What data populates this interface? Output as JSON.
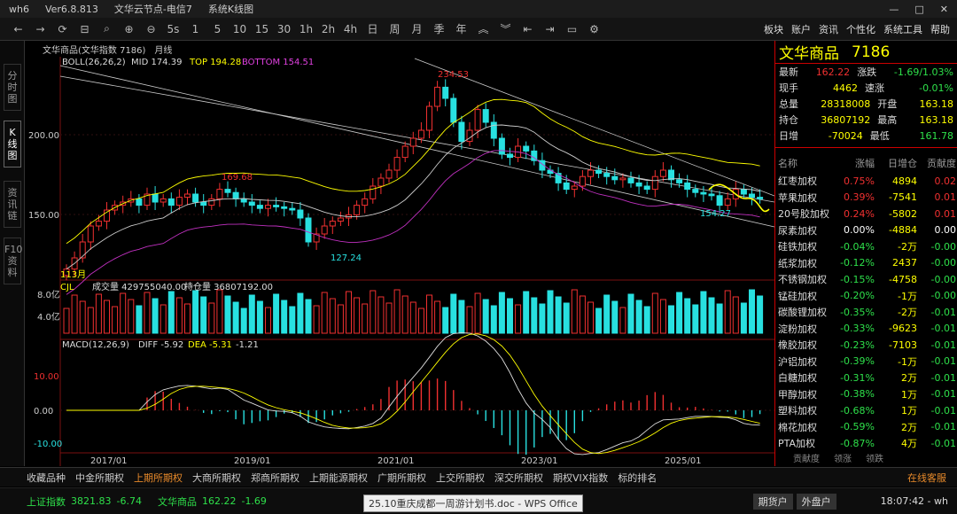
{
  "titlebar": {
    "app": "wh6",
    "version": "Ver6.8.813",
    "server": "文华云节点-电信7",
    "mode": "系统K线图",
    "win": [
      "—",
      "□",
      "✕"
    ]
  },
  "toolbar": {
    "buttons": [
      "←",
      "→",
      "⟳",
      "⊟",
      "⌕",
      "⊕",
      "⊖",
      "5s",
      "1",
      "5",
      "10",
      "15",
      "30",
      "1h",
      "2h",
      "4h",
      "日",
      "周",
      "月",
      "季",
      "年",
      "︽",
      "︾",
      "⇤",
      "⇥",
      "▭",
      "⚙"
    ],
    "menus": [
      "板块",
      "账户",
      "资讯",
      "个性化",
      "系统工具",
      "帮助"
    ]
  },
  "lefttabs": [
    "分时图",
    "K线图",
    "资讯链",
    "F10资料"
  ],
  "chart": {
    "header": "文华商品(文华指数 7186)　月线",
    "boll": {
      "label": "BOLL(26,26,2)",
      "mid": "MID 174.39",
      "top": "TOP 194.28",
      "bottom": "BOTTOM 154.51"
    },
    "price_ticks": [
      "200.00",
      "150.00"
    ],
    "annotations": [
      "234.53",
      "169.68",
      "127.24",
      "154.27"
    ],
    "bottom_label": "113月",
    "vol": {
      "label": "CJL",
      "vol": "成交量 429755040.00",
      "oi": "持仓量 36807192.00",
      "ticks": [
        "8.0亿",
        "4.0亿"
      ]
    },
    "macd": {
      "label": "MACD(12,26,9)",
      "diff": "DIFF -5.92",
      "dea": "DEA -5.31",
      "macd": "-1.21",
      "ticks": [
        "10.00",
        "0.00",
        "-10.00"
      ]
    },
    "dates": [
      "2017/01",
      "2019/01",
      "2021/01",
      "2023/01",
      "2025/01"
    ]
  },
  "chart_data": {
    "type": "candlestick",
    "closes": [
      118,
      125,
      135,
      145,
      148,
      155,
      158,
      160,
      162,
      158,
      165,
      160,
      162,
      158,
      163,
      165,
      160,
      158,
      162,
      168,
      166,
      162,
      160,
      158,
      156,
      158,
      157,
      156,
      155,
      150,
      135,
      140,
      145,
      148,
      150,
      152,
      158,
      162,
      170,
      175,
      180,
      188,
      195,
      200,
      205,
      220,
      232,
      225,
      210,
      198,
      205,
      218,
      210,
      200,
      190,
      188,
      195,
      192,
      186,
      180,
      178,
      172,
      168,
      170,
      176,
      180,
      178,
      176,
      174,
      175,
      172,
      170,
      168,
      176,
      180,
      174,
      172,
      168,
      166,
      165,
      164,
      158,
      162,
      168,
      165,
      163,
      162
    ]
  },
  "quote": {
    "name": "文华商品",
    "code": "7186",
    "rows": [
      [
        "最新",
        "162.22",
        "涨跌",
        "-1.69/1.03%"
      ],
      [
        "现手",
        "4462",
        "速涨",
        "-0.01%"
      ],
      [
        "总量",
        "28318008",
        "开盘",
        "163.18"
      ],
      [
        "持仓",
        "36807192",
        "最高",
        "163.18"
      ],
      [
        "日增",
        "-70024",
        "最低",
        "161.78"
      ]
    ],
    "colheads": [
      "名称",
      "涨幅",
      "日增仓",
      "贡献度"
    ],
    "list": [
      [
        "红枣加权",
        "0.75%",
        "4894",
        "0.02"
      ],
      [
        "苹果加权",
        "0.39%",
        "-7541",
        "0.01"
      ],
      [
        "20号胶加权",
        "0.24%",
        "-5802",
        "0.01"
      ],
      [
        "尿素加权",
        "0.00%",
        "-4884",
        "0.00"
      ],
      [
        "硅铁加权",
        "-0.04%",
        "-2万",
        "-0.00"
      ],
      [
        "纸浆加权",
        "-0.12%",
        "2437",
        "-0.00"
      ],
      [
        "不锈钢加权",
        "-0.15%",
        "-4758",
        "-0.00"
      ],
      [
        "锰硅加权",
        "-0.20%",
        "-1万",
        "-0.00"
      ],
      [
        "碳酸锂加权",
        "-0.35%",
        "-2万",
        "-0.01"
      ],
      [
        "淀粉加权",
        "-0.33%",
        "-9623",
        "-0.01"
      ],
      [
        "橡胶加权",
        "-0.23%",
        "-7103",
        "-0.01"
      ],
      [
        "沪铝加权",
        "-0.39%",
        "-1万",
        "-0.01"
      ],
      [
        "白糖加权",
        "-0.31%",
        "2万",
        "-0.01"
      ],
      [
        "甲醇加权",
        "-0.38%",
        "1万",
        "-0.01"
      ],
      [
        "塑料加权",
        "-0.68%",
        "1万",
        "-0.01"
      ],
      [
        "棉花加权",
        "-0.59%",
        "2万",
        "-0.01"
      ],
      [
        "PTA加权",
        "-0.87%",
        "4万",
        "-0.01"
      ]
    ],
    "tabs": [
      "贡献度",
      "领涨",
      "领跌"
    ]
  },
  "bottomtabs": [
    "收藏品种",
    "中金所期权",
    "上期所期权",
    "大商所期权",
    "郑商所期权",
    "上期能源期权",
    "广期所期权",
    "上交所期权",
    "深交所期权",
    "期权VIX指数",
    "标的排名"
  ],
  "service": "在线客服",
  "status": {
    "idx1": "上证指数",
    "v1": "3821.83",
    "c1": "-6.74",
    "idx2": "文华商品",
    "v2": "162.22",
    "c2": "-1.69",
    "right": [
      "期货户",
      "外盘户"
    ],
    "time": "18:07:42 - wh",
    "tooltip": "25.10重庆成都一周游计划书.doc - WPS Office"
  }
}
